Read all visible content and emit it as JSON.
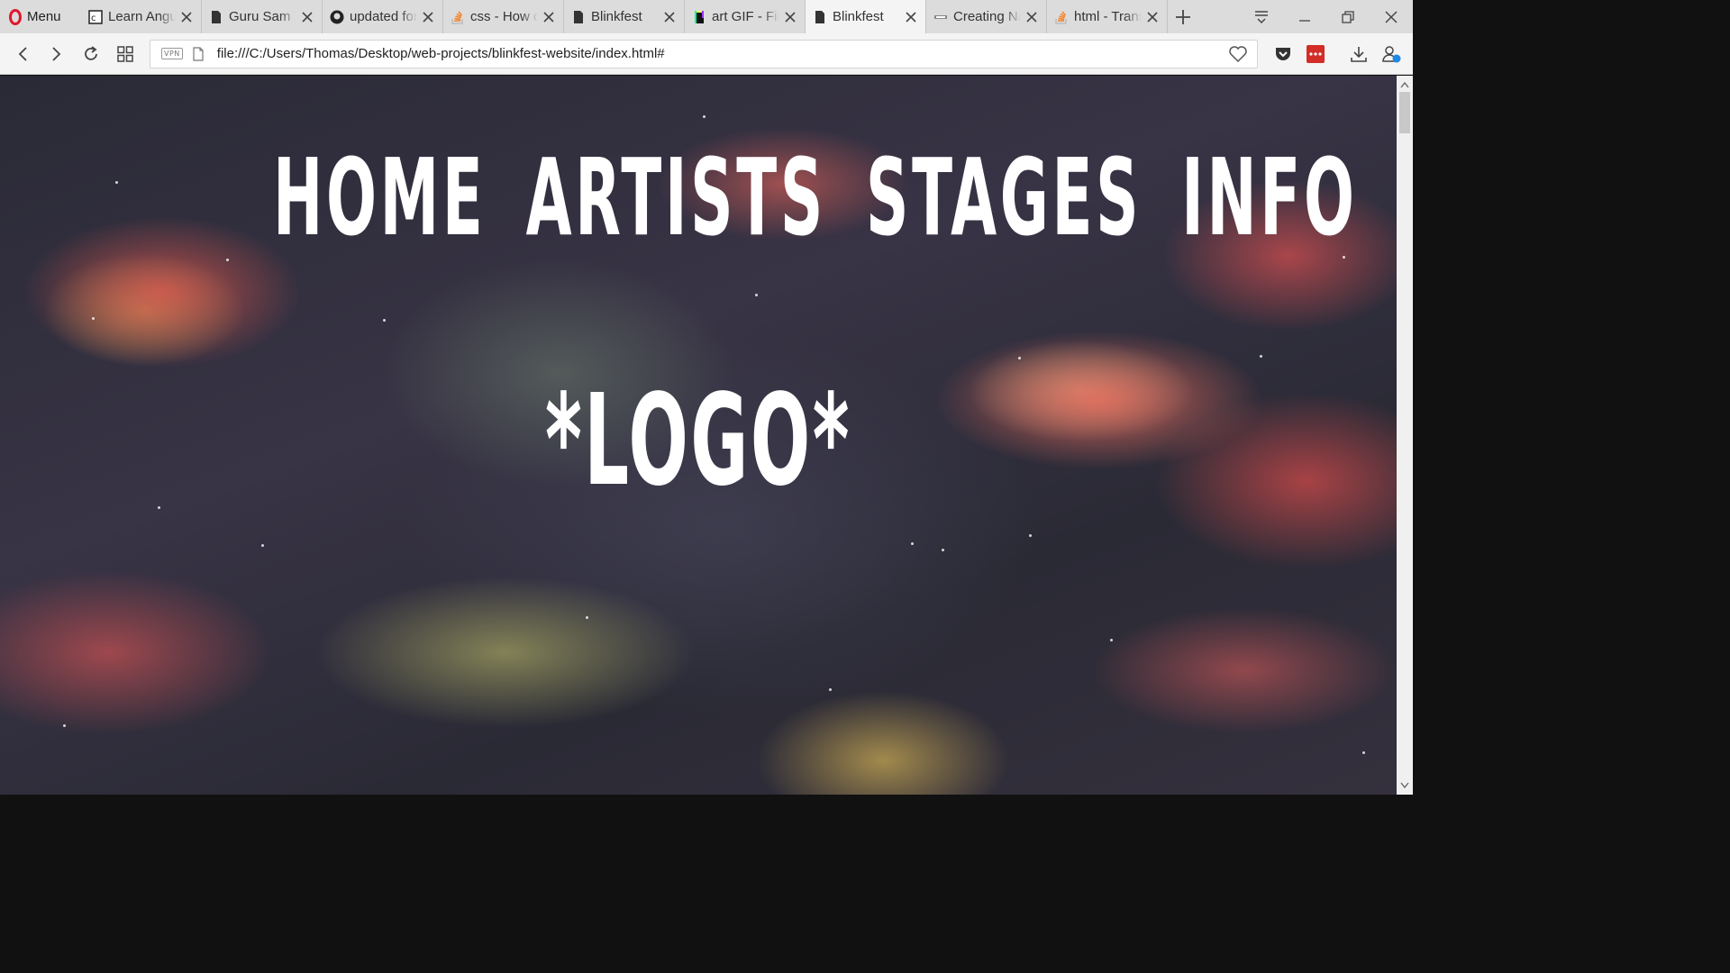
{
  "browser": {
    "menu_label": "Menu",
    "tabs": [
      {
        "title": "Learn Angular",
        "icon": "codecademy-icon",
        "active": false
      },
      {
        "title": "Guru Sam",
        "icon": "page-icon",
        "active": false
      },
      {
        "title": "updated for",
        "icon": "github-icon",
        "active": false
      },
      {
        "title": "css - How do",
        "icon": "stackoverflow-icon",
        "active": false
      },
      {
        "title": "Blinkfest",
        "icon": "page-icon",
        "active": false
      },
      {
        "title": "art GIF - Find",
        "icon": "giphy-icon",
        "active": false
      },
      {
        "title": "Blinkfest",
        "icon": "page-icon",
        "active": true
      },
      {
        "title": "Creating Nav",
        "icon": "site-icon",
        "active": false
      },
      {
        "title": "html - Transp",
        "icon": "stackoverflow-icon",
        "active": false
      }
    ],
    "vpn_label": "VPN",
    "url": "file:///C:/Users/Thomas/Desktop/web-projects/blinkfest-website/index.html#"
  },
  "page": {
    "nav": [
      "HOME",
      "ARTISTS",
      "STAGES",
      "INFO"
    ],
    "logo": "*LOGO*"
  },
  "colors": {
    "opera_red": "#e0162b",
    "tab_strip": "#dcdcdc",
    "active_tab": "#f4f4f4"
  }
}
